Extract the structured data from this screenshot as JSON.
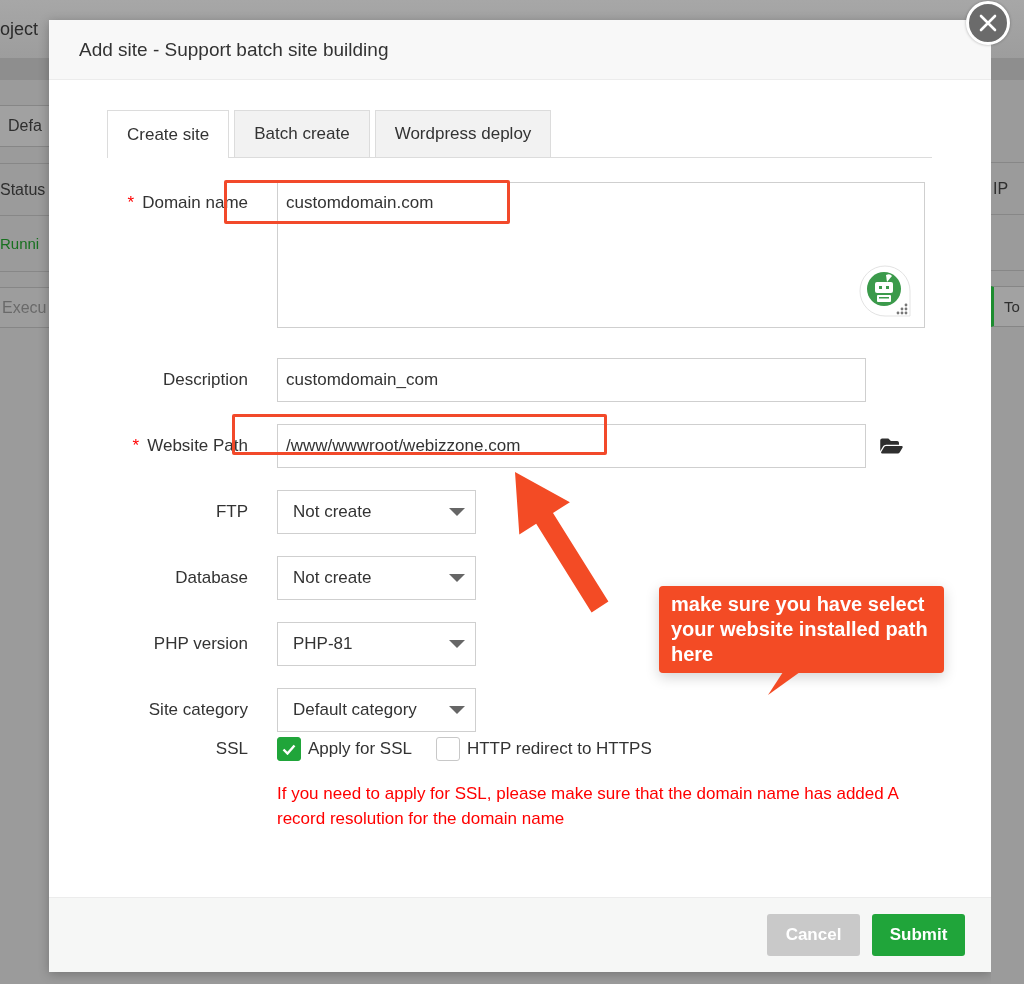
{
  "page": {
    "header_title": "oject",
    "filter_button": "Defa",
    "column_header": "Status",
    "status_cell": "Runni",
    "command_field": {
      "placeholder": "Execu"
    },
    "right_column_header": "IP",
    "right_button": "To"
  },
  "dialog": {
    "title": "Add site - Support batch site building",
    "tabs": [
      {
        "label": "Create site",
        "selected": true
      },
      {
        "label": "Batch create",
        "selected": false
      },
      {
        "label": "Wordpress deploy",
        "selected": false
      }
    ],
    "fields": [
      {
        "kind": "textarea",
        "label": "Domain name",
        "required_mark": "*",
        "value": "customdomain.com"
      },
      {
        "kind": "input",
        "label": "Description",
        "value": "customdomain_com"
      },
      {
        "kind": "path",
        "label": "Website Path",
        "required_mark": "*",
        "value": "/www/wwwroot/webizzone.com"
      },
      {
        "kind": "select",
        "label": "FTP",
        "value": "Not create"
      },
      {
        "kind": "select",
        "label": "Database",
        "value": "Not create"
      },
      {
        "kind": "select",
        "label": "PHP version",
        "value": "PHP-81"
      },
      {
        "kind": "select",
        "label": "Site category",
        "value": "Default category"
      }
    ],
    "ssl": {
      "label": "SSL",
      "options": [
        {
          "label": "Apply for SSL",
          "checked": true
        },
        {
          "label": "HTTP redirect to HTTPS",
          "checked": false
        }
      ],
      "note": "If you need to apply for SSL, please make sure that the domain name has added A record resolution for the domain name"
    },
    "buttons": [
      {
        "label": "Cancel",
        "kind": "secondary"
      },
      {
        "label": "Submit",
        "kind": "primary"
      }
    ]
  },
  "annotation": {
    "callout": "make sure you have select your website installed path here"
  }
}
